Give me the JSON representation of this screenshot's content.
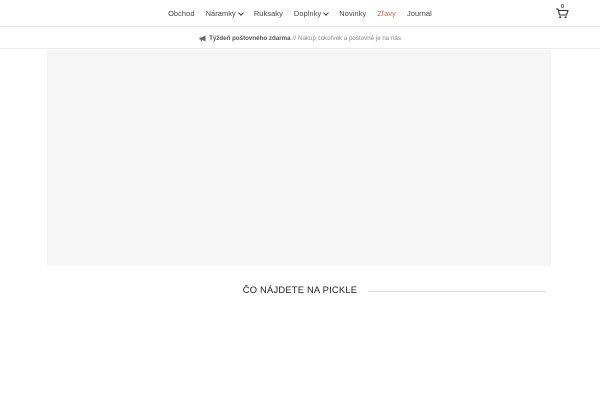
{
  "nav": {
    "items": [
      {
        "label": "Obchod",
        "dropdown": false
      },
      {
        "label": "Náramky",
        "dropdown": true
      },
      {
        "label": "Ruksaky",
        "dropdown": false
      },
      {
        "label": "Doplnky",
        "dropdown": true
      },
      {
        "label": "Novinky",
        "dropdown": false
      },
      {
        "label": "Zľavy",
        "dropdown": false,
        "highlight": true
      },
      {
        "label": "Journal",
        "dropdown": false
      }
    ],
    "cart_count": "0",
    "cart_icon": "shopping-cart-icon"
  },
  "announcement": {
    "icon": "megaphone-icon",
    "bold": "Týždeň poštovného zdarma",
    "separator": "//",
    "text": "Nakúp čokoľvek a poštovné je na nás"
  },
  "section": {
    "title": "ČO NÁJDETE NA PICKLE"
  },
  "colors": {
    "accent": "#e8553e",
    "text": "#444444",
    "hero_bg": "#f6f6f6"
  }
}
